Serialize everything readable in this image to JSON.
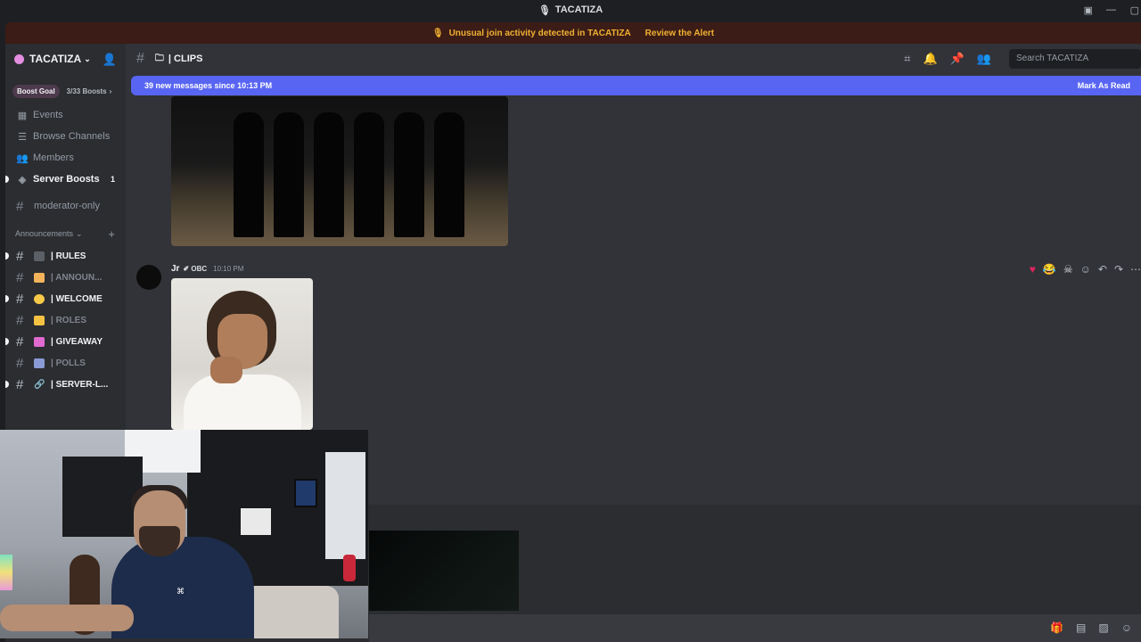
{
  "window": {
    "title": "TACATIZA"
  },
  "alert": {
    "message": "Unusual join activity detected in TACATIZA",
    "action": "Review the Alert"
  },
  "server": {
    "name": "TACATIZA"
  },
  "boost": {
    "goal_label": "Boost Goal",
    "count": "3/33 Boosts"
  },
  "sidebar": {
    "items": [
      {
        "label": "Events",
        "icon": "calendar-icon"
      },
      {
        "label": "Browse Channels",
        "icon": "browse-channels-icon"
      },
      {
        "label": "Members",
        "icon": "members-icon"
      },
      {
        "label": "Server Boosts",
        "icon": "boost-icon",
        "badge": "1"
      }
    ],
    "standalone_channel": "moderator-only",
    "category": "Announcements",
    "channels": [
      {
        "label": "| RULES",
        "emoji_color": "#5b5f66",
        "unread": true
      },
      {
        "label": "| ANNOUN...",
        "emoji_color": "#f2b35b",
        "unread": false
      },
      {
        "label": "| WELCOME",
        "emoji_color": "#f7c948",
        "unread": true
      },
      {
        "label": "| ROLES",
        "emoji_color": "#f5c242",
        "unread": false
      },
      {
        "label": "| GIVEAWAY",
        "emoji_color": "#e06ad0",
        "unread": true
      },
      {
        "label": "| POLLS",
        "emoji_color": "#8a9ad6",
        "unread": false
      },
      {
        "label": "| SERVER-L...",
        "emoji_color": "#b5bac1",
        "unread": true
      }
    ]
  },
  "channel_header": {
    "name": "| CLIPS",
    "search_placeholder": "Search TACATIZA"
  },
  "new_messages": {
    "text": "39 new messages since 10:13 PM",
    "action": "Mark As Read"
  },
  "message": {
    "author": "Jr",
    "tag": "OBC",
    "time": "10:10 PM"
  },
  "colors": {
    "accent": "#5865f2",
    "alert_text": "#f0b132",
    "background": "#313338",
    "sidebar": "#2b2d31"
  }
}
